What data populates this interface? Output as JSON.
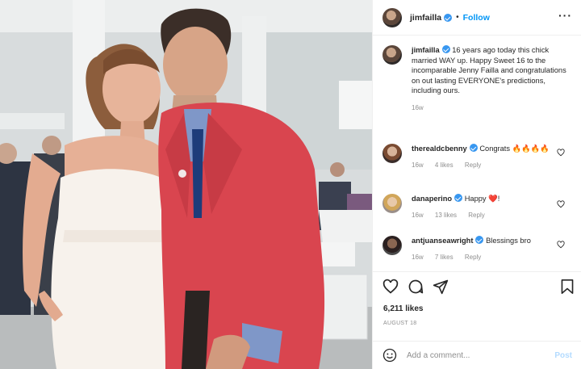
{
  "post": {
    "author": "jimfailla",
    "follow_label": "Follow",
    "dot": "•",
    "more_label": "···",
    "caption_text": "16 years ago today this chick married WAY up. Happy Sweet 16 to the incomparable Jenny Failla and congratulations on out lasting EVERYONE's predictions, including ours.",
    "caption_time": "16w",
    "likes": "6,211 likes",
    "date": "AUGUST 18",
    "add_comment_placeholder": "Add a comment...",
    "post_label": "Post"
  },
  "comments": [
    {
      "user": "therealdcbenny",
      "text": "Congrats 🔥🔥🔥🔥",
      "time": "16w",
      "likes": "4 likes",
      "reply": "Reply"
    },
    {
      "user": "danaperino",
      "text": "Happy ❤️!",
      "time": "16w",
      "likes": "13 likes",
      "reply": "Reply"
    },
    {
      "user": "antjuanseawright",
      "text": "Blessings bro",
      "time": "16w",
      "likes": "7 likes",
      "reply": "Reply"
    }
  ],
  "colors": {
    "accent": "#0095f6",
    "verified": "#3897f0",
    "muted": "#8e8e8e",
    "jacket": "#d9454f"
  },
  "icons": [
    "heart-icon",
    "comment-icon",
    "share-icon",
    "bookmark-icon",
    "more-icon",
    "emoji-icon",
    "verified-icon"
  ]
}
